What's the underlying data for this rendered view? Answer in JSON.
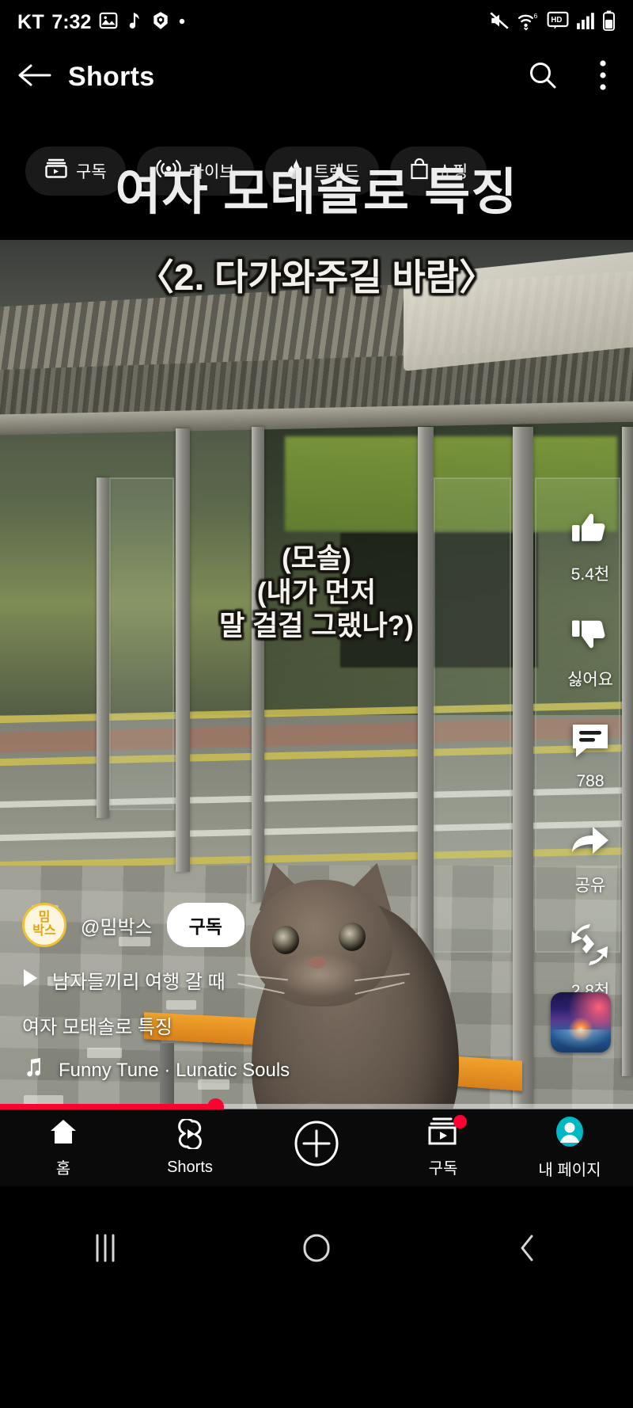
{
  "status_bar": {
    "carrier": "KT",
    "time": "7:32",
    "left_icons": [
      "image-icon",
      "music-note-icon",
      "capsule-icon",
      "dot-icon"
    ],
    "right_icons": [
      "mute-icon",
      "wifi-6-icon",
      "hd-icon",
      "signal-bars-icon",
      "battery-icon"
    ]
  },
  "header": {
    "back_icon": "back-arrow-icon",
    "title": "Shorts",
    "search_icon": "search-icon",
    "more_icon": "more-vertical-icon"
  },
  "chips": [
    {
      "label": "구독",
      "icon": "subscriptions-icon"
    },
    {
      "label": "라이브",
      "icon": "live-broadcast-icon"
    },
    {
      "label": "트렌드",
      "icon": "trending-fire-icon"
    },
    {
      "label": "쇼핑",
      "icon": "shopping-bag-icon"
    }
  ],
  "overlay_title": "여자 모태솔로 특징",
  "video": {
    "subtitle": "〈2. 다가와주길 바람〉",
    "caption_lines": [
      "(모솔)",
      "(내가 먼저",
      "말 걸걸 그랬나?)"
    ]
  },
  "actions": [
    {
      "name": "like",
      "icon": "thumbs-up-icon",
      "label": "5.4천"
    },
    {
      "name": "dislike",
      "icon": "thumbs-down-icon",
      "label": "싫어요"
    },
    {
      "name": "comment",
      "icon": "comment-icon",
      "label": "788"
    },
    {
      "name": "share",
      "icon": "share-arrow-icon",
      "label": "공유"
    },
    {
      "name": "remix",
      "icon": "remix-icon",
      "label": "2.8천"
    }
  ],
  "meta": {
    "avatar_line1": "밈",
    "avatar_line2": "박스",
    "handle": "@밈박스",
    "subscribe_label": "구독",
    "playlist_icon": "play-triangle-icon",
    "playlist_label": "남자들끼리 여행 갈 때",
    "video_title": "여자 모태솔로 특징",
    "music_icon": "music-note-icon",
    "music_label": "Funny Tune · Lunatic Souls",
    "sound_thumbnail": "album-art-thumbnail"
  },
  "progress": {
    "percent": 34,
    "fill_color": "#ff0033"
  },
  "bottom_nav": [
    {
      "label": "홈",
      "icon": "home-icon",
      "badge": false
    },
    {
      "label": "Shorts",
      "icon": "shorts-icon",
      "badge": false
    },
    {
      "label": "",
      "icon": "create-plus-icon",
      "badge": false
    },
    {
      "label": "구독",
      "icon": "subscriptions-box-icon",
      "badge": true
    },
    {
      "label": "내 페이지",
      "icon": "account-avatar-icon",
      "badge": false
    }
  ],
  "android_nav": [
    {
      "icon": "recents-icon"
    },
    {
      "icon": "home-circle-icon"
    },
    {
      "icon": "back-chevron-icon"
    }
  ],
  "colors": {
    "accent_red": "#ff0033",
    "avatar_gold": "#f3c031",
    "profile_teal": "#00b8c4"
  }
}
